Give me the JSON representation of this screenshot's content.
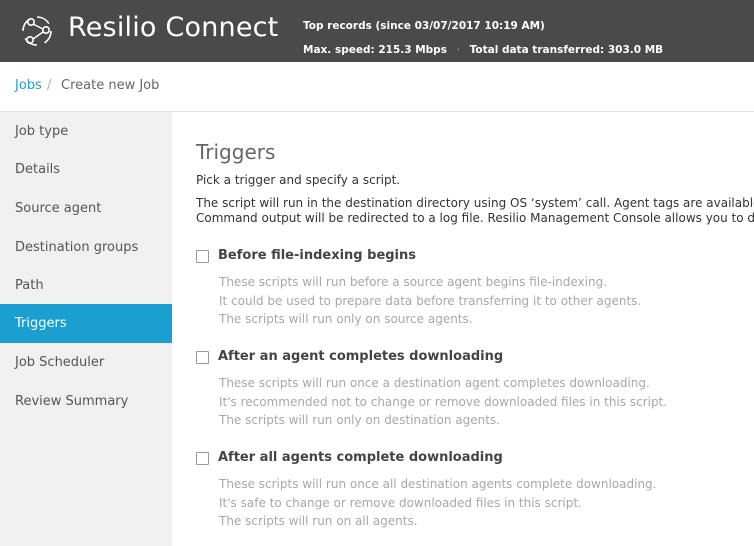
{
  "header": {
    "brand": "Resilio Connect",
    "logo_icon": "resilio-logo-icon",
    "top_records_label": "Top records (since  03/07/2017 10:19 AM)",
    "max_speed_label": "Max. speed:",
    "max_speed_value": "215.3 Mbps",
    "separator": "·",
    "total_label": "Total data transferred:",
    "total_value": "303.0 MB"
  },
  "breadcrumb": {
    "jobs": "Jobs",
    "separator": "/",
    "current": "Create new Job"
  },
  "sidebar": {
    "items": [
      {
        "label": "Job type",
        "active": false
      },
      {
        "label": "Details",
        "active": false
      },
      {
        "label": "Source agent",
        "active": false
      },
      {
        "label": "Destination groups",
        "active": false
      },
      {
        "label": "Path",
        "active": false
      },
      {
        "label": "Triggers",
        "active": true
      },
      {
        "label": "Job Scheduler",
        "active": false
      },
      {
        "label": "Review Summary",
        "active": false
      }
    ]
  },
  "main": {
    "title": "Triggers",
    "intro": "Pick a trigger and specify a script.",
    "desc_line1": "The script will run in the destination directory using OS ‘system’ call. Agent tags are available in",
    "desc_line2": "Command output will be redirected to a log file. Resilio Management Console allows you to do",
    "triggers": [
      {
        "label": "Before file-indexing begins",
        "checked": false,
        "lines": [
          "These scripts will run before a source agent begins file-indexing.",
          "It could be used to prepare data before transferring it to other agents.",
          "The scripts will run only on source agents."
        ]
      },
      {
        "label": "After an agent completes downloading",
        "checked": false,
        "lines": [
          "These scripts will run once a destination agent completes downloading.",
          "It's recommended not to change or remove downloaded files in this script.",
          "The scripts will run only on destination agents."
        ]
      },
      {
        "label": "After all agents complete downloading",
        "checked": false,
        "lines": [
          "These scripts will run once all destination agents complete downloading.",
          "It's safe to change or remove downloaded files in this script.",
          "The scripts will run on all agents."
        ]
      }
    ]
  },
  "colors": {
    "header_bg": "#4a4a4a",
    "accent": "#1a9fd0",
    "sidebar_bg": "#f0f0f0"
  }
}
